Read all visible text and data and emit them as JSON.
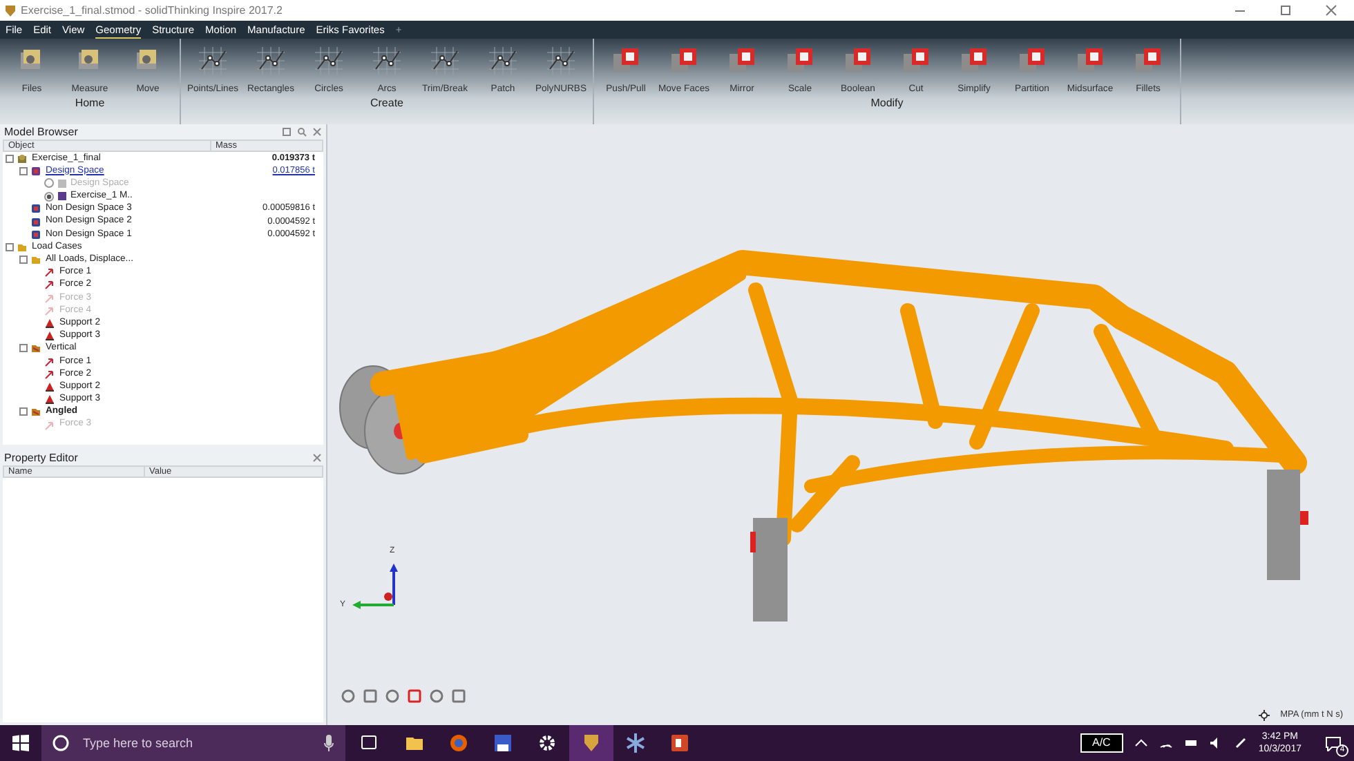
{
  "window": {
    "title": "Exercise_1_final.stmod - solidThinking Inspire 2017.2"
  },
  "menu": [
    {
      "label": "File",
      "selected": false
    },
    {
      "label": "Edit",
      "selected": false
    },
    {
      "label": "View",
      "selected": false
    },
    {
      "label": "Geometry",
      "selected": true
    },
    {
      "label": "Structure",
      "selected": false
    },
    {
      "label": "Motion",
      "selected": false
    },
    {
      "label": "Manufacture",
      "selected": false
    },
    {
      "label": "Eriks Favorites",
      "selected": false
    }
  ],
  "menu_add": "+",
  "ribbon": [
    {
      "group": "Home",
      "kind": "home",
      "tools": [
        "Files",
        "Measure",
        "Move"
      ]
    },
    {
      "group": "Create",
      "kind": "sketch",
      "tools": [
        "Points/Lines",
        "Rectangles",
        "Circles",
        "Arcs",
        "Trim/Break",
        "Patch",
        "PolyNURBS"
      ]
    },
    {
      "group": "Modify",
      "kind": "solid",
      "tools": [
        "Push/Pull",
        "Move Faces",
        "Mirror",
        "Scale",
        "Boolean",
        "Cut",
        "Simplify",
        "Partition",
        "Midsurface",
        "Fillets"
      ]
    }
  ],
  "model_browser": {
    "title": "Model Browser",
    "columns": [
      "Object",
      "Mass"
    ],
    "tree": [
      {
        "label": "Exercise_1_final",
        "kind": "assembly",
        "mass": "0.019373 t",
        "disabled": false,
        "active": false,
        "expanded": true,
        "children": [
          {
            "label": "Design Space",
            "kind": "design",
            "mass": "0.017856 t",
            "disabled": false,
            "active": true,
            "expanded": true,
            "children": [
              {
                "label": "Design Space",
                "kind": "radio",
                "checked": false,
                "disabled": true,
                "active": false
              },
              {
                "label": "Exercise_1 M..",
                "kind": "radio",
                "checked": true,
                "disabled": false,
                "active": false
              }
            ]
          },
          {
            "label": "Non Design Space 3",
            "kind": "part",
            "mass": "0.00059816 t",
            "disabled": false,
            "active": false
          },
          {
            "label": "Non Design Space 2",
            "kind": "part",
            "mass": "0.0004592 t",
            "disabled": false,
            "active": false
          },
          {
            "label": "Non Design Space 1",
            "kind": "part",
            "mass": "0.0004592 t",
            "disabled": false,
            "active": false
          }
        ]
      },
      {
        "label": "Load Cases",
        "kind": "folder",
        "disabled": false,
        "active": false,
        "expanded": true,
        "children": [
          {
            "label": "All Loads, Displace...",
            "kind": "folder",
            "disabled": false,
            "active": false,
            "expanded": true,
            "children": [
              {
                "label": "Force 1",
                "kind": "force",
                "disabled": false,
                "active": false
              },
              {
                "label": "Force 2",
                "kind": "force",
                "disabled": false,
                "active": false
              },
              {
                "label": "Force 3",
                "kind": "force",
                "disabled": true,
                "active": false
              },
              {
                "label": "Force 4",
                "kind": "force",
                "disabled": true,
                "active": false
              },
              {
                "label": "Support 2",
                "kind": "support",
                "disabled": false,
                "active": false
              },
              {
                "label": "Support 3",
                "kind": "support",
                "disabled": false,
                "active": false
              }
            ]
          },
          {
            "label": "Vertical",
            "kind": "loadcase",
            "disabled": false,
            "active": false,
            "expanded": true,
            "children": [
              {
                "label": "Force 1",
                "kind": "force",
                "disabled": false,
                "active": false
              },
              {
                "label": "Force 2",
                "kind": "force",
                "disabled": false,
                "active": false
              },
              {
                "label": "Support 2",
                "kind": "support",
                "disabled": false,
                "active": false
              },
              {
                "label": "Support 3",
                "kind": "support",
                "disabled": false,
                "active": false
              }
            ]
          },
          {
            "label": "Angled",
            "kind": "loadcase",
            "disabled": false,
            "active": true,
            "expanded": true,
            "children": [
              {
                "label": "Force 3",
                "kind": "force",
                "disabled": true,
                "active": false
              }
            ]
          }
        ]
      }
    ]
  },
  "property_editor": {
    "title": "Property Editor",
    "columns": [
      "Name",
      "Value"
    ]
  },
  "viewport": {
    "axes": [
      "Z",
      "Y"
    ],
    "units": "MPA (mm t N s)"
  },
  "taskbar": {
    "search_placeholder": "Type here to search",
    "indicator": "A/C",
    "time": "3:42 PM",
    "date": "10/3/2017",
    "notifications": "4"
  }
}
